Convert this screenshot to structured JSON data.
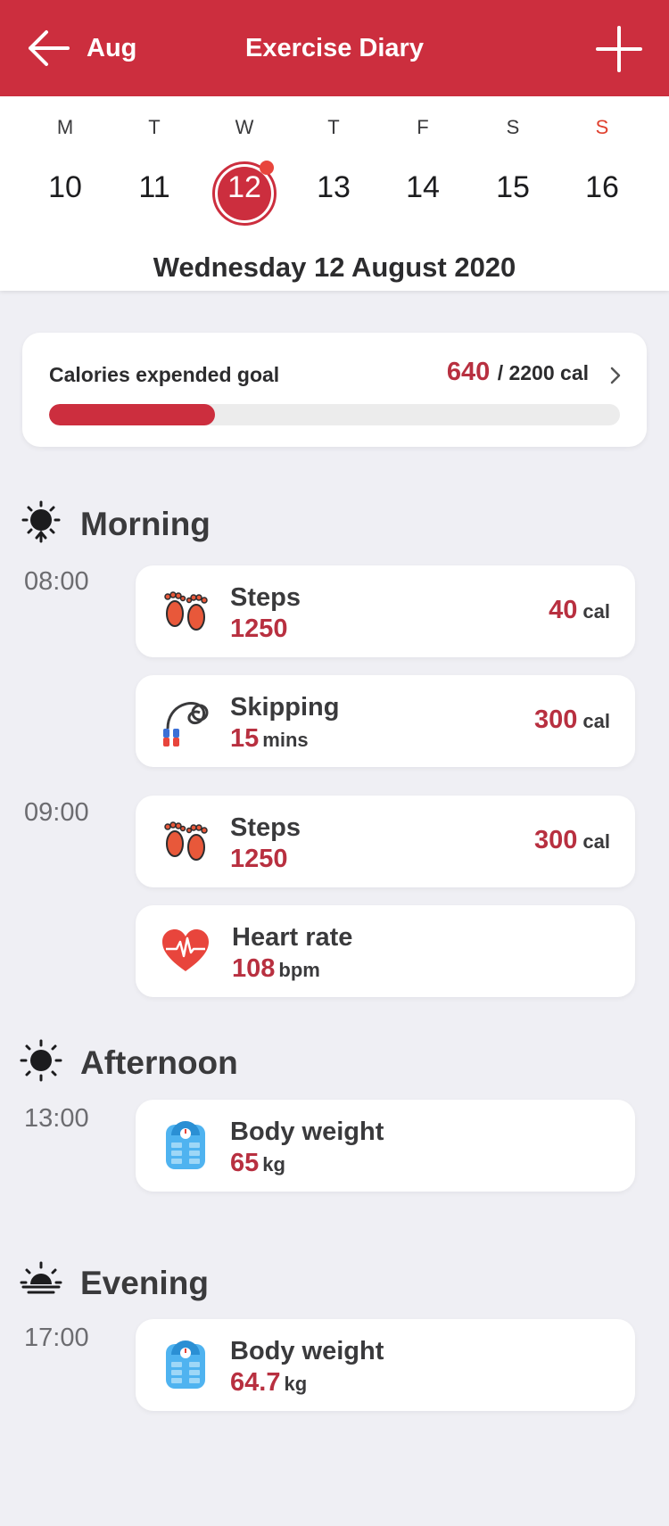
{
  "header": {
    "back_label": "Aug",
    "title": "Exercise Diary",
    "color": "#cc2e3e",
    "back_icon": "arrow-left-icon",
    "add_icon": "plus-icon"
  },
  "calendar": {
    "days": [
      {
        "dow": "M",
        "num": "10"
      },
      {
        "dow": "T",
        "num": "11"
      },
      {
        "dow": "W",
        "num": "12"
      },
      {
        "dow": "T",
        "num": "13"
      },
      {
        "dow": "F",
        "num": "14"
      },
      {
        "dow": "S",
        "num": "15"
      },
      {
        "dow": "S",
        "num": "16"
      }
    ],
    "selected_num": "12",
    "full_date": "Wednesday 12 August 2020"
  },
  "goal": {
    "label": "Calories expended goal",
    "value": "640",
    "total": "/ 2200 cal",
    "progress_fraction": 0.29
  },
  "sections": {
    "morning": "Morning",
    "afternoon": "Afternoon",
    "evening": "Evening"
  },
  "times": {
    "t0800": "08:00",
    "t0900": "09:00",
    "t1300": "13:00",
    "t1700": "17:00"
  },
  "entries": [
    {
      "name": "Steps",
      "value": "1250",
      "unit": "",
      "cal": "40",
      "cal_unit": "cal",
      "icon": "footprints-icon"
    },
    {
      "name": "Skipping",
      "value": "15",
      "unit": "mins",
      "cal": "300",
      "cal_unit": "cal",
      "icon": "jump-rope-icon"
    },
    {
      "name": "Steps",
      "value": "1250",
      "unit": "",
      "cal": "300",
      "cal_unit": "cal",
      "icon": "footprints-icon"
    },
    {
      "name": "Heart rate",
      "value": "108",
      "unit": "bpm",
      "icon": "heart-rate-icon"
    },
    {
      "name": "Body weight",
      "value": "65",
      "unit": "kg",
      "icon": "weight-scale-icon"
    },
    {
      "name": "Body weight",
      "value": "64.7",
      "unit": "kg",
      "icon": "weight-scale-icon"
    }
  ]
}
